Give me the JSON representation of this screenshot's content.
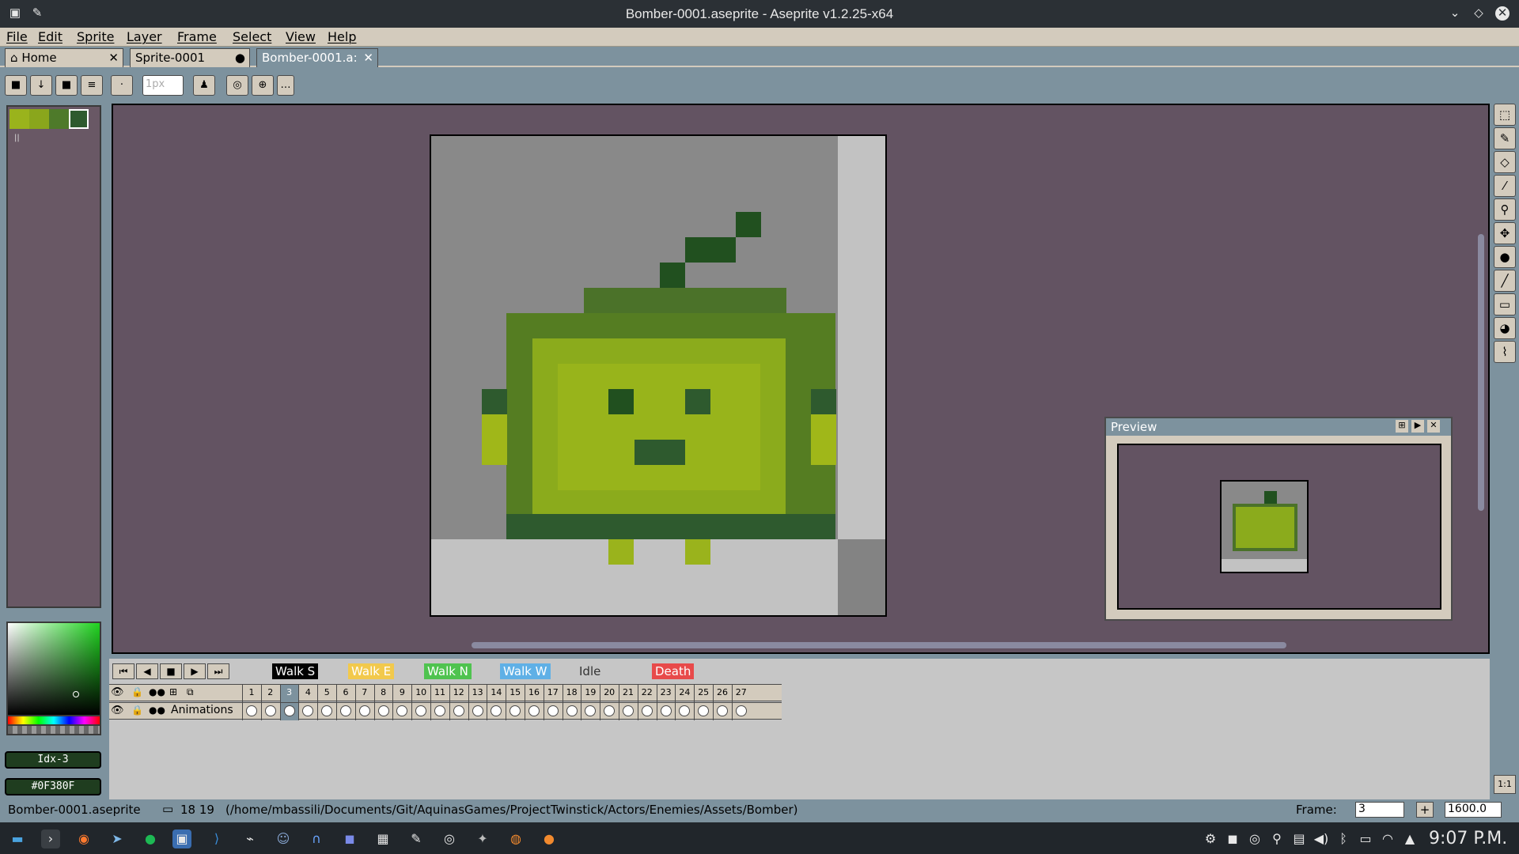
{
  "window": {
    "title": "Bomber-0001.aseprite - Aseprite v1.2.25-x64"
  },
  "menu": [
    "File",
    "Edit",
    "Sprite",
    "Layer",
    "Frame",
    "Select",
    "View",
    "Help"
  ],
  "tabs": [
    {
      "label": "Home",
      "icon": "home-icon"
    },
    {
      "label": "Sprite-0001"
    },
    {
      "label": "Bomber-0001.a:"
    }
  ],
  "toolbar": {
    "brush_size": "1px"
  },
  "palette": {
    "colors": [
      "#9ab31c",
      "#8aa61c",
      "#4e7a2a",
      "#2e5a2e"
    ]
  },
  "color_panel": {
    "index_label": "Idx-3",
    "hex_label": "#0F380F"
  },
  "preview": {
    "title": "Preview"
  },
  "timeline": {
    "tags": [
      {
        "label": "Walk S",
        "color": "#000000"
      },
      {
        "label": "Walk E",
        "color": "#f2c94c"
      },
      {
        "label": "Walk N",
        "color": "#4fc34f"
      },
      {
        "label": "Walk W",
        "color": "#5fb0e6"
      },
      {
        "label": "Idle",
        "color": "#c6c6c6"
      },
      {
        "label": "Death",
        "color": "#e84a4a"
      }
    ],
    "frames": [
      "1",
      "2",
      "3",
      "4",
      "5",
      "6",
      "7",
      "8",
      "9",
      "10",
      "11",
      "12",
      "13",
      "14",
      "15",
      "16",
      "17",
      "18",
      "19",
      "20",
      "21",
      "22",
      "23",
      "24",
      "25",
      "26",
      "27"
    ],
    "current_frame_index": 2,
    "layer_name": "Animations"
  },
  "status": {
    "filename": "Bomber-0001.aseprite",
    "cursor": "18 19",
    "path": "(/home/mbassili/Documents/Git/AquinasGames/ProjectTwinstick/Actors/Enemies/Assets/Bomber)",
    "frame_label": "Frame:",
    "frame_value": "3",
    "zoom_value": "1600.0"
  },
  "taskbar": {
    "clock": "9:07 P.M."
  },
  "colors": {
    "canvas_bg": "#635362",
    "chrome": "#7d929e",
    "panel": "#d3cbbd"
  }
}
